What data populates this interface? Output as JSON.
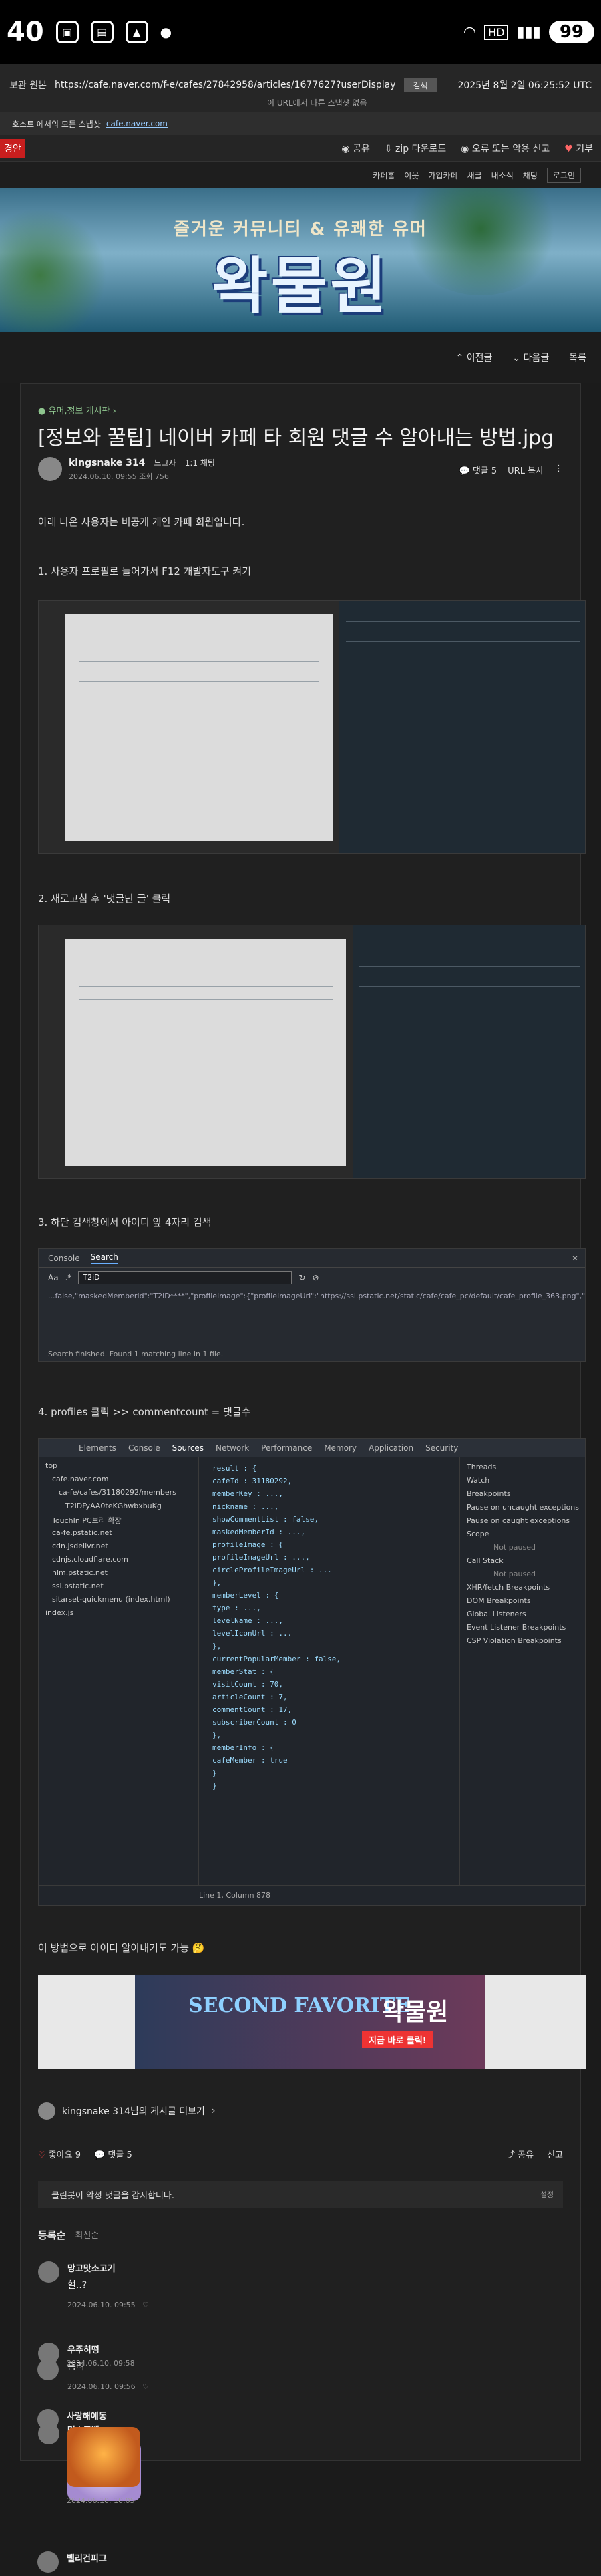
{
  "status": {
    "time": "40",
    "battery": "99",
    "hd": "HD"
  },
  "browser": {
    "label": "보관 원본",
    "url": "https://cafe.naver.com/f-e/cafes/27842958/articles/1677627?userDisplay",
    "go_label": "검색",
    "date": "2025년 8월 2일 06:25:52 UTC",
    "note": "이 URL에서 다른 스냅샷 없음",
    "host_text": "호스트 에서의 모든 스냅샷",
    "host_link": "cafe.naver.com"
  },
  "topbar": {
    "red_tag": "경안",
    "links": [
      "공유",
      "zip 다운로드",
      "오류 또는 악용 신고",
      "기부"
    ]
  },
  "cafe_nav": [
    "카페홈",
    "이웃",
    "가입카페",
    "새글",
    "내소식",
    "채팅",
    "로그인"
  ],
  "banner": {
    "sub": "즐거운 커뮤니티 & 유쾌한 유머",
    "logo": "왁물원"
  },
  "pagenav": {
    "prev": "이전글",
    "next": "다음글",
    "list": "목록"
  },
  "article": {
    "breadcrumb": "유머,정보 게시판",
    "title": "[정보와 꿀팁] 네이버 카페 타 회원 댓글 수 알아내는 방법.jpg",
    "author": "kingsnake 314",
    "level": "느그자",
    "level2": "1:1 채팅",
    "meta": "2024.06.10. 09:55  조회 756",
    "comments_label": "댓글 5",
    "url_copy": "URL 복사",
    "intro": "아래 나온 사용자는 비공개 개인 카페 회원입니다.",
    "step1": "1. 사용자 프로필로 들어가서 F12 개발자도구 켜기",
    "step2": "2. 새로고침 후 '댓글단 글' 클릭",
    "step3": "3. 하단 검색창에서 아이디 앞 4자리 검색",
    "step4": "4. profiles 클릭 >> commentcount = 댓글수",
    "outro": "이 방법으로 아이디 알아내기도 가능"
  },
  "console": {
    "tab1": "Console",
    "tab2": "Search",
    "query": "T2iD",
    "result": "...false,\"maskedMemberId\":\"T2iD****\",\"profileImage\":{\"profileImageUrl\":\"https://ssl.pstatic.net/static/cafe/cafe_pc/default/cafe_profile_363.png\",\"circle",
    "footer": "Search finished.  Found 1 matching line in 1 file."
  },
  "devtools": {
    "tabs": [
      "Elements",
      "Console",
      "Sources",
      "Network",
      "Performance",
      "Memory",
      "Application",
      "Security"
    ],
    "tree": [
      "top",
      "cafe.naver.com",
      "ca-fe/cafes/31180292/members",
      "T2iDFyAA0teKGhwbxbuKg",
      "TouchIn PC브라 확장",
      "ca-fe.pstatic.net",
      "cdn.jsdelivr.net",
      "cdnjs.cloudflare.com",
      "nlm.pstatic.net",
      "ssl.pstatic.net",
      "sitarset-quickmenu (index.html)",
      "index.js"
    ],
    "code": [
      "result : {",
      "  cafeId : 31180292,",
      "  memberKey : ...,",
      "  nickname : ...,",
      "  showCommentList : false,",
      "  maskedMemberId : ...,",
      "  profileImage : {",
      "    profileImageUrl : ...,",
      "    circleProfileImageUrl : ...",
      "  },",
      "  memberLevel : {",
      "    type : ...,",
      "    levelName : ...,",
      "    levelIconUrl : ...",
      "  },",
      "  currentPopularMember : false,",
      "  memberStat : {",
      "    visitCount : 70,",
      "    articleCount : 7,",
      "    commentCount : 17,",
      "    subscriberCount : 0",
      "  },",
      "  memberInfo : {",
      "    cafeMember : true",
      "  }",
      "}"
    ],
    "side": [
      "Threads",
      "Watch",
      "Breakpoints",
      "Pause on uncaught exceptions",
      "Pause on caught exceptions",
      "Scope",
      "Not paused",
      "Call Stack",
      "Not paused",
      "XHR/fetch Breakpoints",
      "DOM Breakpoints",
      "Global Listeners",
      "Event Listener Breakpoints",
      "CSP Violation Breakpoints"
    ],
    "status": "Line 1, Column 878"
  },
  "ad": {
    "text": "SECOND FAVORITE",
    "brand": "왁물원",
    "cta": "지금 바로 클릭!"
  },
  "footer": {
    "board_link": "kingsnake 314님의 게시글 더보기",
    "like": "좋아요 9",
    "comment": "댓글 5",
    "share": "공유",
    "report": "신고",
    "bot": "클린봇이 악성 댓글을 감지합니다.",
    "bot_setting": "설정",
    "comments_head": "등록순",
    "comments_head2": "최신순"
  },
  "comments": [
    {
      "name": "망고맛소고기",
      "text": "헐..?",
      "date": "2024.06.10. 09:55"
    },
    {
      "name": "우주히떵",
      "text": "흠려",
      "date": "2024.06.10. 09:56"
    },
    {
      "name": "머스포밸",
      "text": "",
      "date": "2024.06.10. 09:58"
    },
    {
      "name": "사랑해예동",
      "text": "",
      "date": "2024.06.10. 10:05"
    },
    {
      "name": "벨리건피그",
      "text": "",
      "date": ""
    }
  ]
}
